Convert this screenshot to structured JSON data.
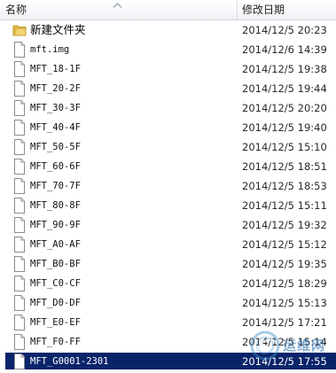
{
  "columns": {
    "name_label": "名称",
    "date_label": "修改日期",
    "sort_direction": "ascending",
    "sort_icon": "sort-up-icon"
  },
  "items": [
    {
      "name": "新建文件夹",
      "date": "2014/12/5 20:23",
      "type": "folder",
      "icon": "folder-icon",
      "selected": false
    },
    {
      "name": "mft.img",
      "date": "2014/12/6 14:39",
      "type": "file",
      "icon": "file-icon",
      "selected": false
    },
    {
      "name": "MFT_18-1F",
      "date": "2014/12/5 19:38",
      "type": "file",
      "icon": "file-icon",
      "selected": false
    },
    {
      "name": "MFT_20-2F",
      "date": "2014/12/5 19:44",
      "type": "file",
      "icon": "file-icon",
      "selected": false
    },
    {
      "name": "MFT_30-3F",
      "date": "2014/12/5 20:20",
      "type": "file",
      "icon": "file-icon",
      "selected": false
    },
    {
      "name": "MFT_40-4F",
      "date": "2014/12/5 19:40",
      "type": "file",
      "icon": "file-icon",
      "selected": false
    },
    {
      "name": "MFT_50-5F",
      "date": "2014/12/5 15:10",
      "type": "file",
      "icon": "file-icon",
      "selected": false
    },
    {
      "name": "MFT_60-6F",
      "date": "2014/12/5 18:51",
      "type": "file",
      "icon": "file-icon",
      "selected": false
    },
    {
      "name": "MFT_70-7F",
      "date": "2014/12/5 18:53",
      "type": "file",
      "icon": "file-icon",
      "selected": false
    },
    {
      "name": "MFT_80-8F",
      "date": "2014/12/5 15:11",
      "type": "file",
      "icon": "file-icon",
      "selected": false
    },
    {
      "name": "MFT_90-9F",
      "date": "2014/12/5 19:32",
      "type": "file",
      "icon": "file-icon",
      "selected": false
    },
    {
      "name": "MFT_A0-AF",
      "date": "2014/12/5 15:12",
      "type": "file",
      "icon": "file-icon",
      "selected": false
    },
    {
      "name": "MFT_B0-BF",
      "date": "2014/12/5 19:35",
      "type": "file",
      "icon": "file-icon",
      "selected": false
    },
    {
      "name": "MFT_C0-CF",
      "date": "2014/12/5 18:29",
      "type": "file",
      "icon": "file-icon",
      "selected": false
    },
    {
      "name": "MFT_D0-DF",
      "date": "2014/12/5 15:13",
      "type": "file",
      "icon": "file-icon",
      "selected": false
    },
    {
      "name": "MFT_E0-EF",
      "date": "2014/12/5 17:21",
      "type": "file",
      "icon": "file-icon",
      "selected": false
    },
    {
      "name": "MFT_F0-FF",
      "date": "2014/12/5 15:14",
      "type": "file",
      "icon": "file-icon",
      "selected": false
    },
    {
      "name": "MFT_G0001-2301",
      "date": "2014/12/5 17:55",
      "type": "file",
      "icon": "file-icon",
      "selected": true
    }
  ],
  "watermark": {
    "text": "运维网",
    "icon": "watermark-logo-icon"
  },
  "colors": {
    "selection": "#0a246a",
    "folder": "#e8c04a",
    "header_border": "#d5d9de"
  }
}
